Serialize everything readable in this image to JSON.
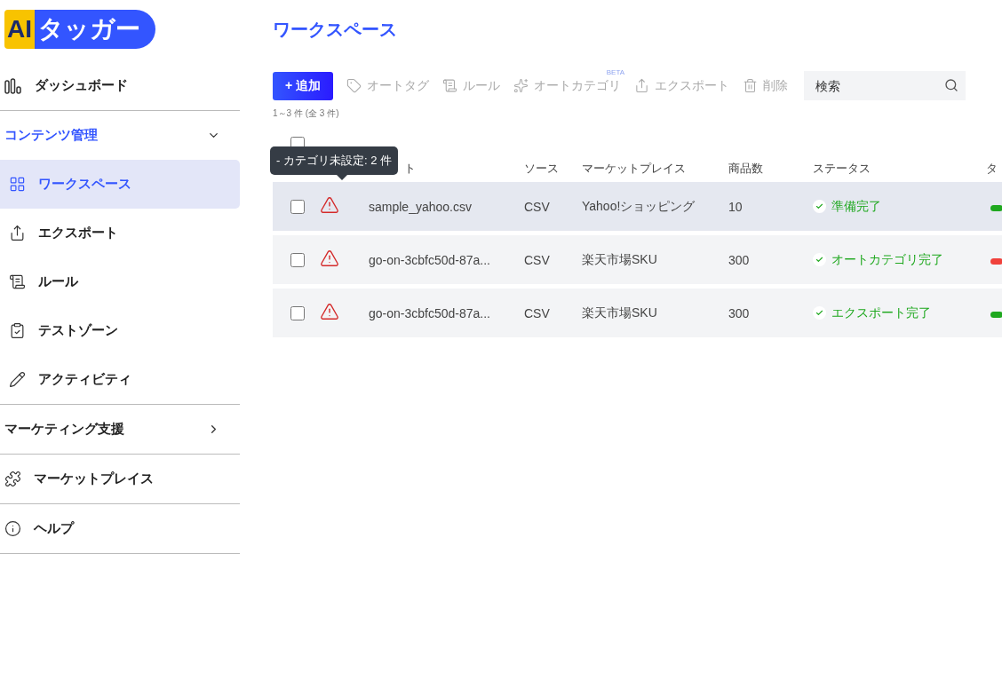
{
  "sidebar": {
    "logo": {
      "part_1": "AI",
      "part_2": "タッガー"
    },
    "items": [
      {
        "kind": "link",
        "label": "ダッシュボード",
        "selected": false
      },
      {
        "kind": "group",
        "label": "コンテンツ管理",
        "expanded": true,
        "children": [
          {
            "kind": "link",
            "label": "ワークスペース",
            "selected": true
          },
          {
            "kind": "link",
            "label": "エクスポート",
            "selected": false
          },
          {
            "kind": "link",
            "label": "ルール",
            "selected": false
          },
          {
            "kind": "link",
            "label": "テストゾーン",
            "selected": false
          },
          {
            "kind": "link",
            "label": "アクティビティ",
            "selected": false
          }
        ]
      },
      {
        "kind": "group",
        "label": "マーケティング支援",
        "expanded": false
      },
      {
        "kind": "link",
        "label": "マーケットプレイス",
        "selected": false
      },
      {
        "kind": "link",
        "label": "ヘルプ",
        "selected": false
      }
    ]
  },
  "page": {
    "title": "ワークスペース"
  },
  "toolbar": [
    {
      "label": "+ 追加",
      "disabled": false
    },
    {
      "label": "オートタグ",
      "disabled": true
    },
    {
      "label": "ルール",
      "disabled": true
    },
    {
      "label": "オートカテゴリ",
      "disabled": true,
      "badge": "BETA"
    },
    {
      "label": "エクスポート",
      "disabled": true
    },
    {
      "label": "削除",
      "disabled": true
    }
  ],
  "search": {
    "placeholder": "検索"
  },
  "count": "1～3 件 (全 3 件)",
  "table": {
    "select_all": {
      "checked": false
    },
    "columns": [
      "ト",
      "ソース",
      "マーケットプレイス",
      "商品数",
      "ステータス",
      "タ"
    ],
    "tooltip": "- カテゴリ未設定: 2 件",
    "rows": [
      {
        "checked": false,
        "highlighted": true,
        "warning": true,
        "name": "sample_yahoo.csv",
        "source": "CSV",
        "marketplace": "Yahoo!ショッピング",
        "count": "10",
        "status": "準備完了",
        "color": "#1fa81f"
      },
      {
        "checked": false,
        "highlighted": false,
        "warning": true,
        "name": "go-on-3cbfc50d-87a...",
        "source": "CSV",
        "marketplace": "楽天市場SKU",
        "count": "300",
        "status": "オートカテゴリ完了",
        "color": "#f0413b"
      },
      {
        "checked": false,
        "highlighted": false,
        "warning": true,
        "name": "go-on-3cbfc50d-87a...",
        "source": "CSV",
        "marketplace": "楽天市場SKU",
        "count": "300",
        "status": "エクスポート完了",
        "color": "#1fa81f"
      }
    ]
  }
}
